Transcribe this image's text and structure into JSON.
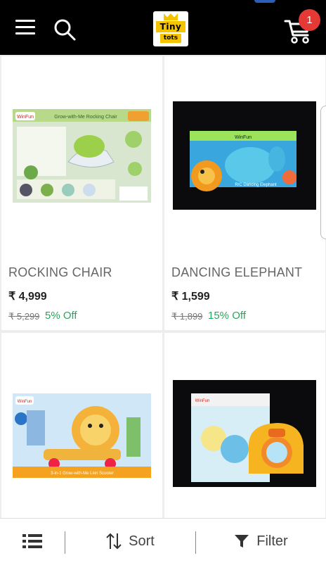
{
  "header": {
    "logo_line1": "Tiny",
    "logo_line2": "tots",
    "cart_count": "1",
    "menu_icon": "hamburger-menu-icon",
    "search_icon": "search-icon",
    "cart_icon": "cart-icon"
  },
  "products": [
    {
      "name": "ROCKING CHAIR",
      "price": "₹ 4,999",
      "mrp": "₹ 5,299",
      "discount": "5% Off",
      "image_text": "Grow-with-Me Rocking Chair",
      "brand": "WinFun"
    },
    {
      "name": "DANCING ELEPHANT",
      "price": "₹ 1,599",
      "mrp": "₹ 1,899",
      "discount": "15% Off",
      "image_text": "R/C Dancing Elephant",
      "brand": "WinFun"
    },
    {
      "name": "",
      "price": "",
      "mrp": "",
      "discount": "",
      "image_text": "3-in-1 Grow-with-Me Lion Scooter",
      "brand": "WinFun"
    },
    {
      "name": "",
      "price": "",
      "mrp": "",
      "discount": "",
      "image_text": "",
      "brand": "WinFun"
    }
  ],
  "bottom_bar": {
    "sort_label": "Sort",
    "filter_label": "Filter",
    "view_icon": "list-view-icon",
    "sort_icon": "sort-arrows-icon",
    "filter_icon": "filter-funnel-icon"
  },
  "colors": {
    "header_bg": "#000000",
    "badge": "#e53935",
    "discount": "#26a65b",
    "logo_yellow": "#f5c400"
  }
}
